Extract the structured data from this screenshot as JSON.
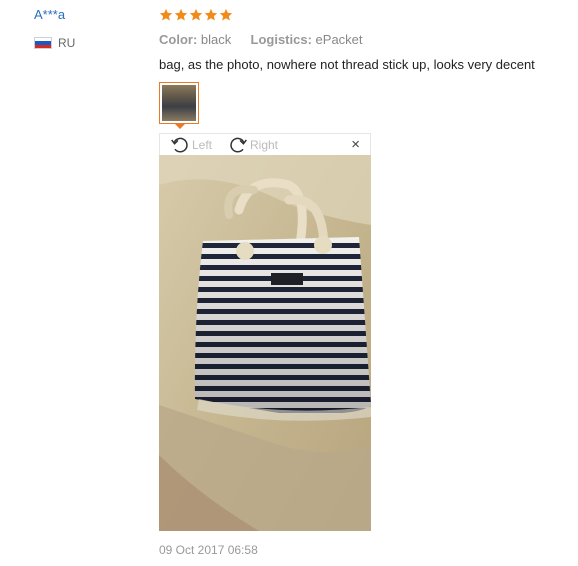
{
  "reviewer": {
    "name": "A***a",
    "country_code": "RU",
    "flag_colors": [
      "#ffffff",
      "#1c57c7",
      "#d52b1e"
    ]
  },
  "review": {
    "rating": 5,
    "star_color": "#f28a1a",
    "color_label": "Color:",
    "color_value": "black",
    "logistics_label": "Logistics:",
    "logistics_value": "ePacket",
    "text": "bag, as the photo, nowhere not thread stick up, looks very decent",
    "date": "09 Oct 2017 06:58"
  },
  "viewer": {
    "rotate_left_label": "Left",
    "rotate_right_label": "Right",
    "close_label": "×",
    "accent_color": "#e77b27"
  }
}
